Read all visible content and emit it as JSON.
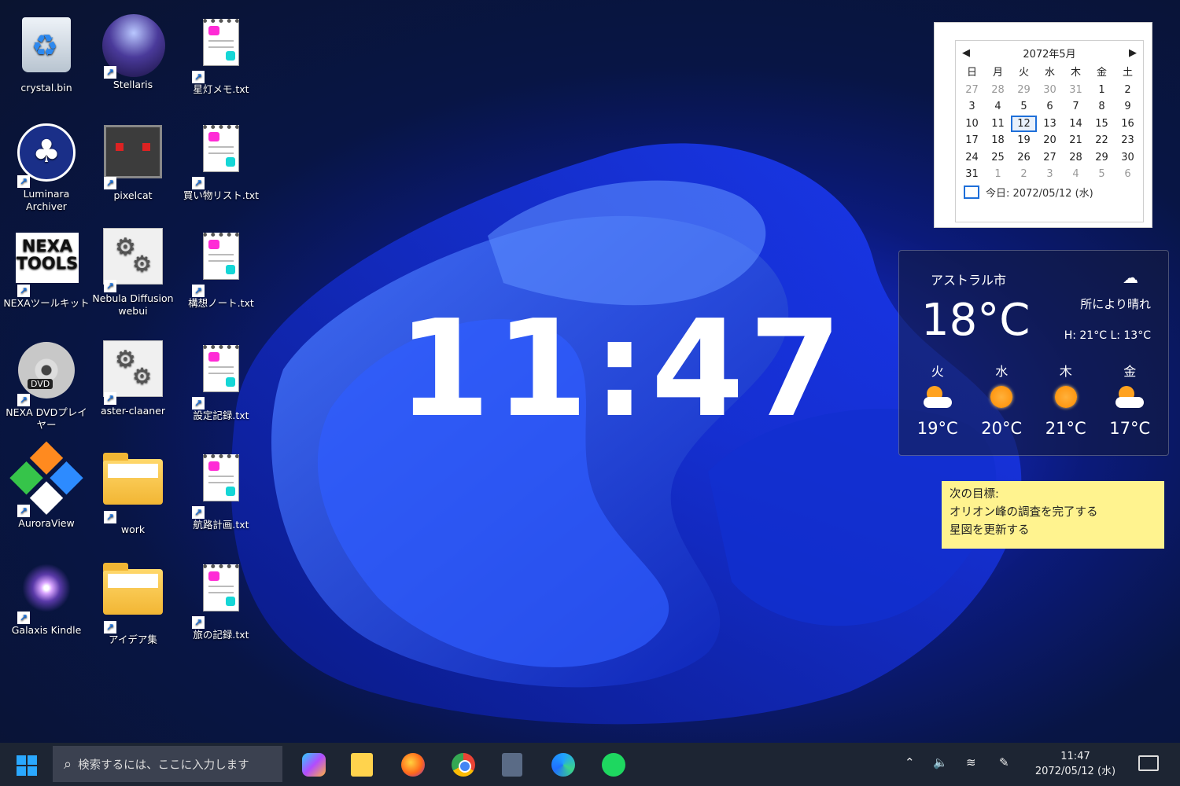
{
  "desktop_icons": [
    {
      "label": "crystal.bin",
      "icon": "recycle-bin-icon"
    },
    {
      "label": "Stellaris",
      "icon": "stellaris-icon"
    },
    {
      "label": "星灯メモ.txt",
      "icon": "text-file-icon"
    },
    {
      "label": "Luminara Archiver",
      "icon": "tree-icon"
    },
    {
      "label": "pixelcat",
      "icon": "pixelcat-icon"
    },
    {
      "label": "買い物リスト.txt",
      "icon": "text-file-icon"
    },
    {
      "label": "NEXAツールキット",
      "icon": "nexa-tools-icon",
      "logo": "NEXA TOOLS"
    },
    {
      "label": "Nebula Diffusion webui",
      "icon": "gears-icon"
    },
    {
      "label": "構想ノート.txt",
      "icon": "text-file-icon"
    },
    {
      "label": "NEXA DVDプレイヤー",
      "icon": "dvd-icon",
      "logo": "DVD"
    },
    {
      "label": "aster-claaner",
      "icon": "gears-icon"
    },
    {
      "label": "設定記録.txt",
      "icon": "text-file-icon"
    },
    {
      "label": "AuroraView",
      "icon": "aurora-icon"
    },
    {
      "label": "work",
      "icon": "folder-icon"
    },
    {
      "label": "航路計画.txt",
      "icon": "text-file-icon"
    },
    {
      "label": "Galaxis Kindle",
      "icon": "galaxy-icon"
    },
    {
      "label": "アイデア集",
      "icon": "folder-icon"
    },
    {
      "label": "旅の記録.txt",
      "icon": "text-file-icon"
    }
  ],
  "clock": {
    "time": "11:47"
  },
  "calendar": {
    "month_label": "2072年5月",
    "weekdays": [
      "日",
      "月",
      "火",
      "水",
      "木",
      "金",
      "土"
    ],
    "weeks": [
      [
        "27",
        "28",
        "29",
        "30",
        "31",
        "1",
        "2"
      ],
      [
        "3",
        "4",
        "5",
        "6",
        "7",
        "8",
        "9"
      ],
      [
        "10",
        "11",
        "12",
        "13",
        "14",
        "15",
        "16"
      ],
      [
        "17",
        "18",
        "19",
        "20",
        "21",
        "22",
        "23"
      ],
      [
        "24",
        "25",
        "26",
        "27",
        "28",
        "29",
        "30"
      ],
      [
        "31",
        "1",
        "2",
        "3",
        "4",
        "5",
        "6"
      ]
    ],
    "selected": "12",
    "today_label": "今日: 2072/05/12 (水)"
  },
  "weather": {
    "city": "アストラル市",
    "temp": "18°C",
    "condition": "所により晴れ",
    "high_low": "H: 21°C L: 13°C",
    "forecast": [
      {
        "day": "火",
        "icon": "partly-sunny-icon",
        "temp": "19°C"
      },
      {
        "day": "水",
        "icon": "sun-icon",
        "temp": "20°C"
      },
      {
        "day": "木",
        "icon": "sun-icon",
        "temp": "21°C"
      },
      {
        "day": "金",
        "icon": "partly-sunny-icon",
        "temp": "17°C"
      }
    ]
  },
  "sticky_note": {
    "lines": [
      "次の目標:",
      "オリオン峰の調査を完了する",
      "星図を更新する"
    ]
  },
  "taskbar": {
    "search_placeholder": "検索するには、ここに入力します",
    "apps": [
      "copilot-icon",
      "file-explorer-icon",
      "firefox-icon",
      "chrome-icon",
      "calculator-icon",
      "edge-icon",
      "spotify-icon"
    ],
    "time": "11:47",
    "date": "2072/05/12 (水)"
  }
}
